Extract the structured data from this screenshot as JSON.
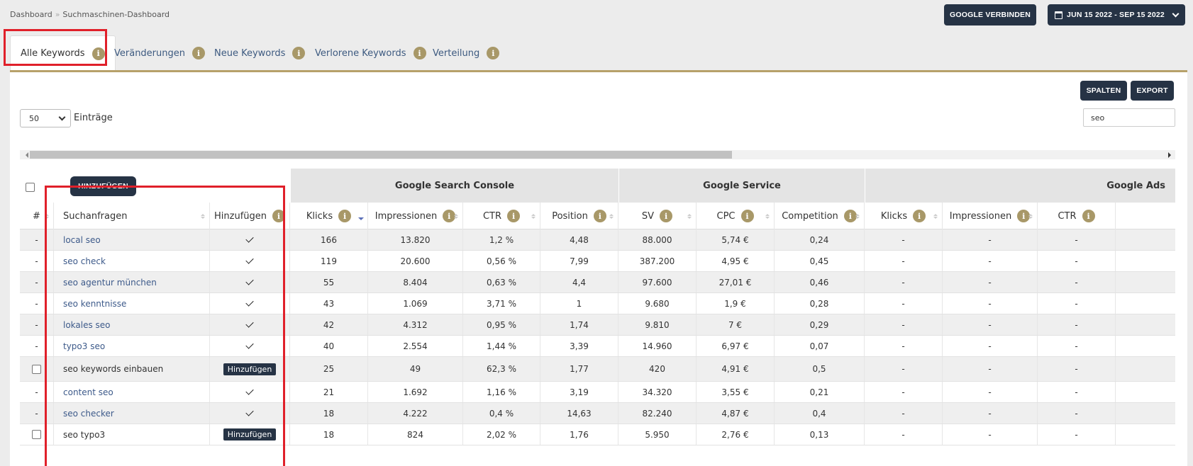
{
  "breadcrumb": [
    "Dashboard",
    "Suchmaschinen-Dashboard"
  ],
  "header": {
    "google_button": "GOOGLE VERBINDEN",
    "date_range": "JUN 15 2022 - SEP 15 2022"
  },
  "tabs": [
    {
      "label": "Alle Keywords",
      "active": true
    },
    {
      "label": "Veränderungen"
    },
    {
      "label": "Neue Keywords"
    },
    {
      "label": "Verlorene Keywords"
    },
    {
      "label": "Verteilung"
    }
  ],
  "toolbar": {
    "spalten": "SPALTEN",
    "export": "EXPORT",
    "length_value": "50",
    "length_label": "Einträge",
    "search_value": "seo",
    "add_button": "HINZUFÜGEN"
  },
  "groups": [
    "Google Search Console",
    "Google Service",
    "Google Ads"
  ],
  "columns": [
    "#",
    "Suchanfragen",
    "Hinzufügen",
    "Klicks",
    "Impressionen",
    "CTR",
    "Position",
    "SV",
    "CPC",
    "Competition",
    "Klicks",
    "Impressionen",
    "CTR"
  ],
  "add_badge_label": "Hinzufügen",
  "info_glyph": "i",
  "rows": [
    {
      "num": "-",
      "kw": "local seo",
      "linked": true,
      "added": true,
      "cells": [
        "166",
        "13.820",
        "1,2 %",
        "4,48",
        "88.000",
        "5,74 €",
        "0,24",
        "-",
        "-",
        "-"
      ]
    },
    {
      "num": "-",
      "kw": "seo check",
      "linked": true,
      "added": true,
      "cells": [
        "119",
        "20.600",
        "0,56 %",
        "7,99",
        "387.200",
        "4,95 €",
        "0,45",
        "-",
        "-",
        "-"
      ]
    },
    {
      "num": "-",
      "kw": "seo agentur münchen",
      "linked": true,
      "added": true,
      "cells": [
        "55",
        "8.404",
        "0,63 %",
        "4,4",
        "97.600",
        "27,01 €",
        "0,46",
        "-",
        "-",
        "-"
      ]
    },
    {
      "num": "-",
      "kw": "seo kenntnisse",
      "linked": true,
      "added": true,
      "cells": [
        "43",
        "1.069",
        "3,71 %",
        "1",
        "9.680",
        "1,9 €",
        "0,28",
        "-",
        "-",
        "-"
      ]
    },
    {
      "num": "-",
      "kw": "lokales seo",
      "linked": true,
      "added": true,
      "cells": [
        "42",
        "4.312",
        "0,95 %",
        "1,74",
        "9.810",
        "7 €",
        "0,29",
        "-",
        "-",
        "-"
      ]
    },
    {
      "num": "-",
      "kw": "typo3 seo",
      "linked": true,
      "added": true,
      "cells": [
        "40",
        "2.554",
        "1,44 %",
        "3,39",
        "14.960",
        "6,97 €",
        "0,07",
        "-",
        "-",
        "-"
      ]
    },
    {
      "num": "checkbox",
      "kw": "seo keywords einbauen",
      "linked": false,
      "added": false,
      "cells": [
        "25",
        "49",
        "62,3 %",
        "1,77",
        "420",
        "4,91 €",
        "0,5",
        "-",
        "-",
        "-"
      ]
    },
    {
      "num": "-",
      "kw": "content seo",
      "linked": true,
      "added": true,
      "cells": [
        "21",
        "1.692",
        "1,16 %",
        "3,19",
        "34.320",
        "3,55 €",
        "0,21",
        "-",
        "-",
        "-"
      ]
    },
    {
      "num": "-",
      "kw": "seo checker",
      "linked": true,
      "added": true,
      "cells": [
        "18",
        "4.222",
        "0,4 %",
        "14,63",
        "82.240",
        "4,87 €",
        "0,4",
        "-",
        "-",
        "-"
      ]
    },
    {
      "num": "checkbox",
      "kw": "seo typo3",
      "linked": false,
      "added": false,
      "cells": [
        "18",
        "824",
        "2,02 %",
        "1,76",
        "5.950",
        "2,76 €",
        "0,13",
        "-",
        "-",
        "-"
      ]
    }
  ],
  "colors": {
    "accent": "#b7a16a",
    "info_icon": "#a89868",
    "dark_button": "#263345",
    "link": "#3d5a8a",
    "highlight": "#e0202a"
  }
}
